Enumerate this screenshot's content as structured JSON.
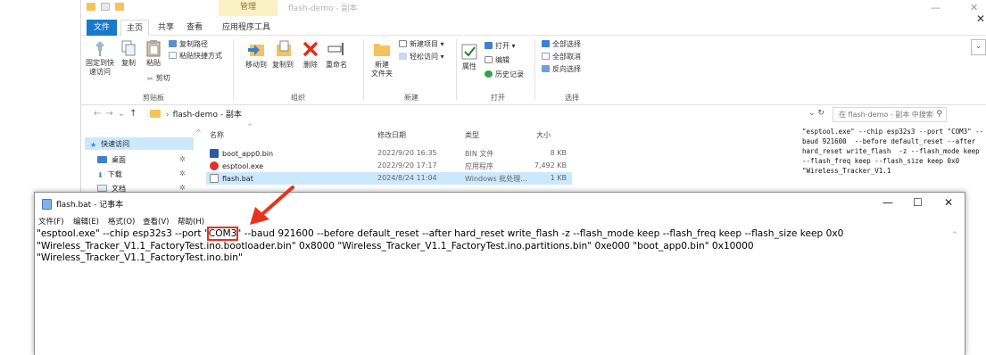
{
  "explorer": {
    "window_title": "flash-demo - 副本",
    "context_tab": "管理",
    "window_controls": {
      "minimize": "—",
      "maximize": "☐",
      "close": "✕"
    },
    "tabs": [
      {
        "label": "文件"
      },
      {
        "label": "主页"
      },
      {
        "label": "共享"
      },
      {
        "label": "查看"
      },
      {
        "label": "应用程序工具"
      }
    ],
    "ribbon": {
      "clipboard": {
        "pin": "固定到快\n速访问",
        "copy": "复制",
        "paste": "粘贴",
        "copy_path": "复制路径",
        "paste_shortcut": "粘贴快捷方式",
        "cut": "剪切",
        "label": "剪贴板"
      },
      "organize": {
        "move_to": "移动到",
        "copy_to": "复制到",
        "delete": "删除",
        "rename": "重命名",
        "label": "组织"
      },
      "new": {
        "new_folder": "新建\n文件夹",
        "new_item": "新建项目 ▾",
        "easy_access": "轻松访问 ▾",
        "label": "新建"
      },
      "open": {
        "properties": "属性",
        "open": "打开 ▾",
        "edit": "编辑",
        "history": "历史记录",
        "label": "打开"
      },
      "select": {
        "select_all": "全部选择",
        "select_none": "全部取消",
        "invert": "反向选择",
        "label": "选择"
      }
    },
    "address": {
      "path": "flash-demo - 副本",
      "separator": "›",
      "search_placeholder": "在 flash-demo - 副本 中搜索"
    },
    "nav": {
      "quick_access": "快速访问",
      "items": [
        {
          "label": "桌面"
        },
        {
          "label": "下载"
        },
        {
          "label": "文档"
        }
      ]
    },
    "columns": {
      "name": "名称",
      "date": "修改日期",
      "type": "类型",
      "size": "大小"
    },
    "files": [
      {
        "name": "boot_app0.bin",
        "date": "2022/9/20 16:35",
        "type": "BIN 文件",
        "size": "8 KB"
      },
      {
        "name": "esptool.exe",
        "date": "2022/9/20 17:17",
        "type": "应用程序",
        "size": "7,492 KB"
      },
      {
        "name": "flash.bat",
        "date": "2024/8/24 11:04",
        "type": "Windows 批处理...",
        "size": "1 KB"
      }
    ],
    "preview_text": "\"esptool.exe\" --chip esp32s3 --port \"COM3\" --baud 921600  --before default_reset --after hard_reset write_flash  -z --flash_mode keep --flash_freq keep --flash_size keep 0x0 \"Wireless_Tracker_V1.1"
  },
  "notepad": {
    "title": "flash.bat - 记事本",
    "window_controls": {
      "minimize": "—",
      "maximize": "☐",
      "close": "✕"
    },
    "menu": [
      {
        "label": "文件(F)"
      },
      {
        "label": "编辑(E)"
      },
      {
        "label": "格式(O)"
      },
      {
        "label": "查看(V)"
      },
      {
        "label": "帮助(H)"
      }
    ],
    "content": {
      "line1_before": "\"esptool.exe\" --chip esp32s3 --port \"",
      "line1_highlight": "COM3",
      "line1_after": "\" --baud 921600  --before default_reset --after hard_reset write_flash  -z --flash_mode keep --flash_freq keep --flash_size keep 0x0",
      "line2": "\"Wireless_Tracker_V1.1_FactoryTest.ino.bootloader.bin\" 0x8000 \"Wireless_Tracker_V1.1_FactoryTest.ino.partitions.bin\" 0xe000 \"boot_app0.bin\" 0x10000",
      "line3": "\"Wireless_Tracker_V1.1_FactoryTest.ino.bin\""
    }
  },
  "colors": {
    "highlight_box": "#e8331c",
    "arrow": "#e8331c",
    "file_tab": "#1979ca",
    "selection": "#cce8ff"
  }
}
